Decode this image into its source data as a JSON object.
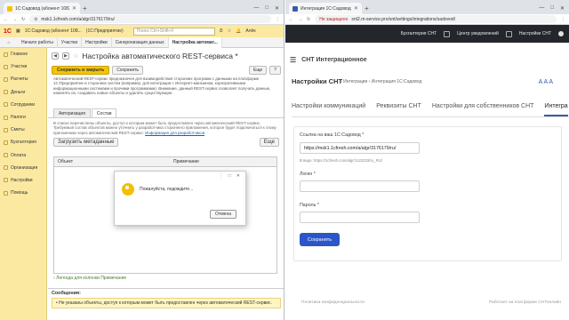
{
  "left_browser": {
    "tab_title": "1С:Садовод (абонент 10829)",
    "url": "msk1.1cfresh.com/a/algr/3176179/ru/",
    "window_controls": [
      "—",
      "□",
      "✕"
    ]
  },
  "onec": {
    "app_title": "1С:Садовод (абонент 108...",
    "app_sub": "(1С:Предприятие)",
    "search_placeholder": "Поиск Ctrl+Shift+F",
    "user": "Алёк",
    "open_tabs": [
      "Начало работы",
      "Участки",
      "Настройки",
      "Синхронизация данных",
      "Настройка автомат..."
    ],
    "sidebar": [
      "Главное",
      "Участки",
      "Расчеты",
      "Деньги",
      "Сотрудники",
      "Налоги",
      "Сметы",
      "Бухгалтерия",
      "Оплата",
      "Организация",
      "Настройки",
      "Помощь"
    ],
    "form_title": "Настройка автоматического REST-сервиса *",
    "save_close": "Сохранить и закрыть",
    "save": "Сохранить",
    "more": "Еще",
    "help": "?",
    "description": "Автоматический REST-сервис предназначен для взаимодействия сторонних программ с данными на платформе 1С:Предприятие и сторонних систем (например, для интеграции с Интернет-магазином, корпоративными информационными системами и прочими программами). Внимание, данный REST-сервис позволяет получать данные, изменять их, создавать новые объекты и удалять существующие.",
    "form_tabs": [
      "Авторизация",
      "Состав"
    ],
    "panel_text": "В списке перечислены объекты, доступ к которым может быть предоставлен через автоматический REST-сервис. Требуемый состав объектов можно уточнить у разработчика стороннего приложения, которое будет подключаться к этому приложению через автоматический REST-сервис:",
    "panel_link": "Информация для разработчиков",
    "load_meta": "Загрузить метаданные",
    "more2": "Еще",
    "columns": [
      "Объект",
      "Примечание"
    ],
    "legend": "Легенда для колонки Примечание",
    "messages_title": "Сообщения:",
    "message": "Не указаны объекты, доступ к которым может быть предоставлен через автоматический REST-сервис.",
    "dialog_text": "Пожалуйста, подождите...",
    "dialog_cancel": "Отмена"
  },
  "right_browser": {
    "tab_title": "Интеграция 1С:Садовод",
    "not_secure": "Не защищено",
    "url": "snt2.m-service.pro/snt/settings/integrations/sadovod/"
  },
  "snt": {
    "nav_items": [
      "Бухгалтерия СНТ",
      "Центр уведомлений",
      "Настройки СНТ"
    ],
    "brand": "СНТ Интеграционное",
    "page_title": "Настройки СНТ",
    "breadcrumb": [
      "Интеграции",
      "Интеграция 1С:Садовод"
    ],
    "font_sizes": "A A A",
    "tabs": [
      "Настройки коммуникаций",
      "Реквизиты СНТ",
      "Настройки для собственников СНТ",
      "Интегра"
    ],
    "link_label": "Ссылка на ваш 1С:Садовод *",
    "link_value": "https://msk1.1cfresh.com/a/algr/3176179/ru/",
    "link_hint": "В виде: https://1cfresh.com/algr/1122233/ru_RU/",
    "login_label": "Логин *",
    "password_label": "Пароль *",
    "save_button": "Сохранить",
    "footer_left": "Политика конфиденциальности",
    "footer_right": "Работает на платформе СНТонлайн"
  }
}
